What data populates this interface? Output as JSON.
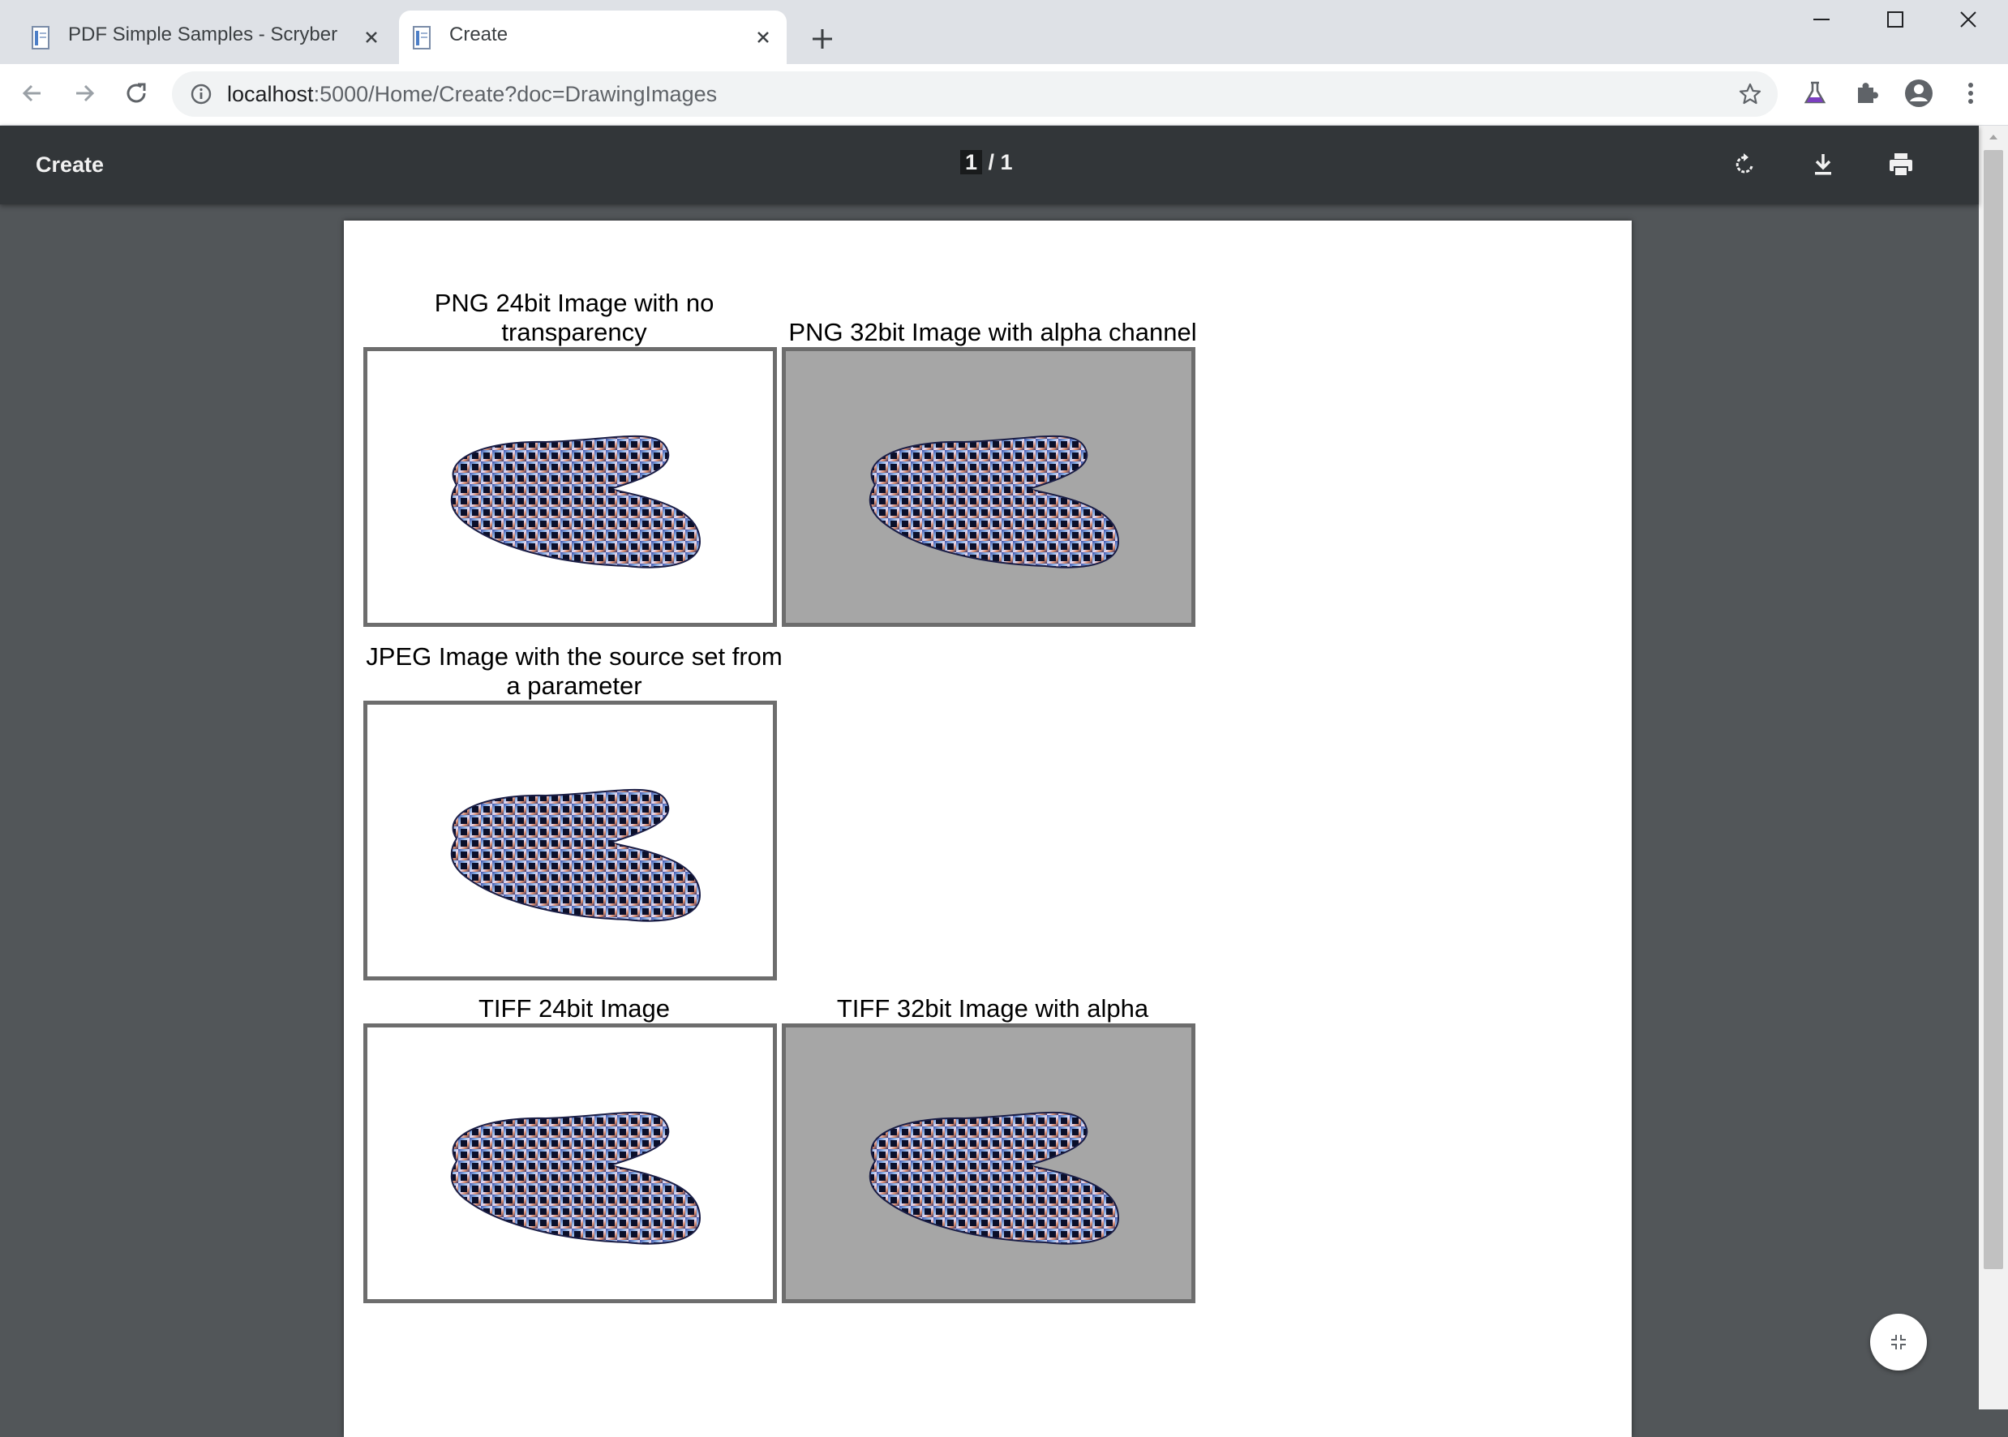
{
  "browser": {
    "tabs": [
      {
        "title": "PDF Simple Samples - Scryber",
        "active": false
      },
      {
        "title": "Create",
        "active": true
      }
    ],
    "address": {
      "host": "localhost",
      "path": ":5000/Home/Create?doc=DrawingImages"
    }
  },
  "pdf_viewer": {
    "title": "Create",
    "page_current": "1",
    "page_rest": " / 1"
  },
  "document": {
    "images": [
      {
        "caption": "PNG 24bit Image with no transparency",
        "background": "white"
      },
      {
        "caption": "PNG 32bit Image with alpha channel",
        "background": "grey"
      },
      {
        "caption": "JPEG Image with the source set from a parameter",
        "background": "white"
      },
      {
        "caption": "TIFF 24bit Image",
        "background": "white"
      },
      {
        "caption": "TIFF 32bit Image with alpha",
        "background": "grey"
      }
    ]
  },
  "icons": {
    "tab_favicon": "pdf-document-icon",
    "back": "arrow-left-icon",
    "forward": "arrow-right-icon",
    "reload": "reload-icon",
    "site_info": "info-circle-icon",
    "bookmark": "star-icon",
    "labs": "flask-icon",
    "extensions": "puzzle-icon",
    "profile": "account-circle-icon",
    "menu": "kebab-menu-icon",
    "rotate": "rotate-icon",
    "download": "download-icon",
    "print": "print-icon",
    "fit": "fit-to-page-icon"
  },
  "colors": {
    "pdf_toolbar": "#323639",
    "viewer_bg": "#525659",
    "tabstrip": "#dee1e6",
    "image_frame": "#6d6d6d",
    "alpha_bg": "#a6a6a6"
  }
}
